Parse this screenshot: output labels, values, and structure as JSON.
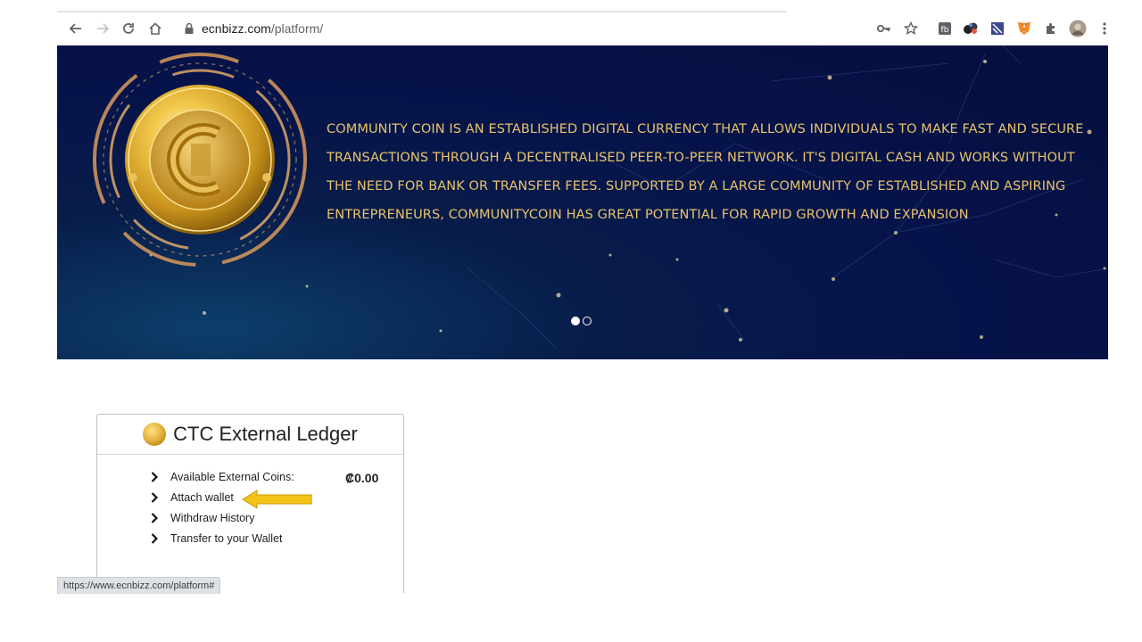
{
  "browser": {
    "url_host": "ecnbizz.com",
    "url_path": "/platform/",
    "status_url": "https://www.ecnbizz.com/platform#"
  },
  "hero": {
    "text": "COMMUNITY COIN IS AN ESTABLISHED DIGITAL CURRENCY THAT ALLOWS INDIVIDUALS TO MAKE FAST AND SECURE TRANSACTIONS THROUGH A DECENTRALISED PEER-TO-PEER NETWORK. IT'S DIGITAL CASH AND WORKS WITHOUT THE NEED FOR BANK OR TRANSFER FEES. SUPPORTED BY A LARGE COMMUNITY OF ESTABLISHED AND ASPIRING ENTREPRENEURS, COMMUNITYCOIN HAS GREAT POTENTIAL FOR RAPID GROWTH AND EXPANSION",
    "coin_logo_text": "COMMUNITY COIN",
    "slides": 2,
    "active_slide": 1,
    "text_color": "#e8c36a"
  },
  "ledger": {
    "title": "CTC External Ledger",
    "items": [
      {
        "label": "Available External Coins:"
      },
      {
        "label": "Attach wallet"
      },
      {
        "label": "Withdraw History"
      },
      {
        "label": "Transfer to your Wallet"
      }
    ],
    "balance": "₡0.00",
    "accent_color": "#f3c416"
  },
  "icons": {
    "back": "arrow-left-icon",
    "forward": "arrow-right-icon",
    "reload": "reload-icon",
    "home": "home-icon",
    "lock": "lock-icon",
    "key": "key-icon",
    "star": "star-icon",
    "extensions": [
      "extension-1-icon",
      "extension-2-icon",
      "extension-3-icon",
      "metamask-icon",
      "puzzle-icon"
    ],
    "profile": "avatar",
    "menu": "kebab-menu-icon"
  }
}
